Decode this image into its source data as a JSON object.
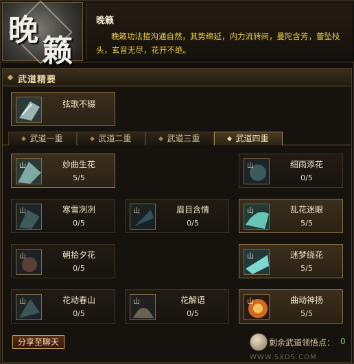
{
  "header": {
    "title": "晚籁",
    "emblem_chars": [
      "晚",
      "籁"
    ],
    "description": "晚籁功法揎沟通自然，其势绵延，内力流转间，曼陀含芳，蕾坠枝头，玄音无尽，花开不绝。"
  },
  "section": {
    "title": "武道精要"
  },
  "essence": {
    "name": "弦歌不辍",
    "icon": "essence-icon"
  },
  "tabs": [
    {
      "label": "武道一重"
    },
    {
      "label": "武道二重"
    },
    {
      "label": "武道三重"
    },
    {
      "label": "武道四重",
      "active": true
    }
  ],
  "skills": [
    {
      "name": "妙曲生花",
      "level": "5/5",
      "active": true
    },
    {
      "name": "细雨添花",
      "level": "0/5"
    },
    {
      "name": "寒雪冽冽",
      "level": "0/5"
    },
    {
      "name": "眉目含情",
      "level": "0/5"
    },
    {
      "name": "乱花迷眼",
      "level": "5/5",
      "active": true
    },
    {
      "name": "朝拾夕花",
      "level": "0/5"
    },
    {
      "name": "迷梦绕花",
      "level": "5/5",
      "active": true
    },
    {
      "name": "花动春山",
      "level": "0/5"
    },
    {
      "name": "花解语",
      "level": "0/5"
    },
    {
      "name": "曲动神扬",
      "level": "5/5",
      "active": true
    }
  ],
  "share_button": "分享至聊天",
  "points": {
    "label": "剩余武道领悟点：",
    "value": "0"
  },
  "watermark": "WWW.SXDS.COM",
  "colors": {
    "gold_text": "#f0d34a",
    "points_green": "#6cd36c",
    "border_gold": "#8a7044"
  }
}
